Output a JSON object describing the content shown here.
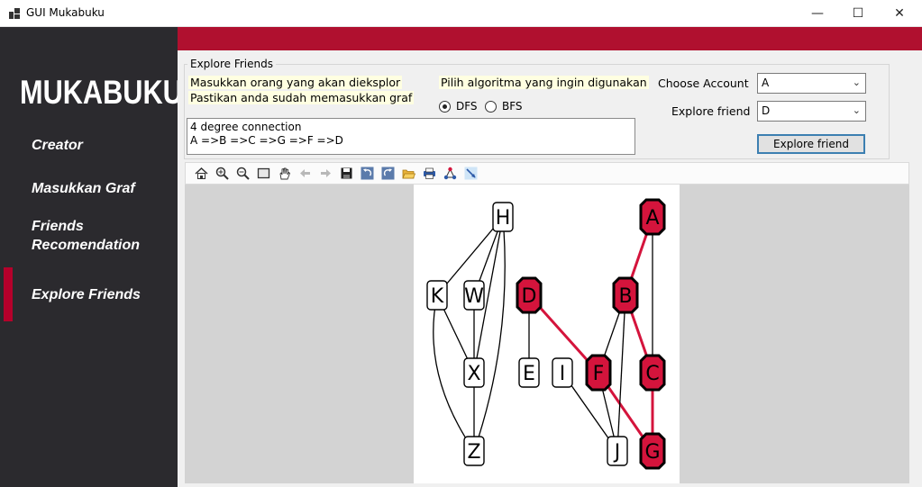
{
  "window": {
    "title": "GUI Mukabuku",
    "minimize": "—",
    "maximize": "☐",
    "close": "✕"
  },
  "sidebar": {
    "brand": "MUKABUKU",
    "items": [
      {
        "label": "Creator"
      },
      {
        "label": "Masukkan Graf"
      },
      {
        "label": "Friends\nRecomendation"
      },
      {
        "label": "Explore Friends",
        "active": true
      }
    ]
  },
  "panel": {
    "group_title": "Explore Friends",
    "instruction_line1": "Masukkan orang yang akan dieksplor",
    "instruction_line2": "Pastikan anda sudah memasukkan graf",
    "algo_label": "Pilih algoritma yang ingin digunakan",
    "radio_dfs": "DFS",
    "radio_bfs": "BFS",
    "selected_algorithm": "DFS",
    "choose_account_label": "Choose Account",
    "choose_account_value": "A",
    "explore_friend_label": "Explore friend",
    "explore_friend_value": "D",
    "explore_button": "Explore friend",
    "output_line1": "4 degree connection",
    "output_line2": "A =>B =>C =>G =>F =>D"
  },
  "toolbar": {
    "icons": [
      "home-icon",
      "zoom-in-icon",
      "zoom-out-icon",
      "fit-icon",
      "pan-hand-icon",
      "back-arrow-icon",
      "forward-arrow-icon",
      "save-icon",
      "undo-icon",
      "redo-icon",
      "open-folder-icon",
      "print-icon",
      "layout-icon",
      "pointer-icon"
    ]
  },
  "graph": {
    "highlight_color": "#d4143c",
    "nodes": [
      {
        "id": "H",
        "highlighted": false
      },
      {
        "id": "K",
        "highlighted": false
      },
      {
        "id": "W",
        "highlighted": false
      },
      {
        "id": "X",
        "highlighted": false
      },
      {
        "id": "Z",
        "highlighted": false
      },
      {
        "id": "D",
        "highlighted": true
      },
      {
        "id": "E",
        "highlighted": false
      },
      {
        "id": "I",
        "highlighted": false
      },
      {
        "id": "F",
        "highlighted": true
      },
      {
        "id": "J",
        "highlighted": false
      },
      {
        "id": "A",
        "highlighted": true
      },
      {
        "id": "B",
        "highlighted": true
      },
      {
        "id": "C",
        "highlighted": true
      },
      {
        "id": "G",
        "highlighted": true
      }
    ],
    "edges": [
      {
        "from": "H",
        "to": "K",
        "path": false
      },
      {
        "from": "H",
        "to": "W",
        "path": false
      },
      {
        "from": "H",
        "to": "X",
        "path": false
      },
      {
        "from": "H",
        "to": "Z",
        "path": false
      },
      {
        "from": "K",
        "to": "X",
        "path": false
      },
      {
        "from": "K",
        "to": "Z",
        "path": false
      },
      {
        "from": "W",
        "to": "X",
        "path": false
      },
      {
        "from": "X",
        "to": "Z",
        "path": false
      },
      {
        "from": "D",
        "to": "E",
        "path": false
      },
      {
        "from": "D",
        "to": "F",
        "path": true
      },
      {
        "from": "I",
        "to": "J",
        "path": false
      },
      {
        "from": "F",
        "to": "J",
        "path": false
      },
      {
        "from": "F",
        "to": "G",
        "path": true
      },
      {
        "from": "A",
        "to": "B",
        "path": true
      },
      {
        "from": "A",
        "to": "C",
        "path": false
      },
      {
        "from": "B",
        "to": "C",
        "path": true
      },
      {
        "from": "B",
        "to": "F",
        "path": false
      },
      {
        "from": "B",
        "to": "J",
        "path": false
      },
      {
        "from": "C",
        "to": "G",
        "path": true
      }
    ]
  }
}
